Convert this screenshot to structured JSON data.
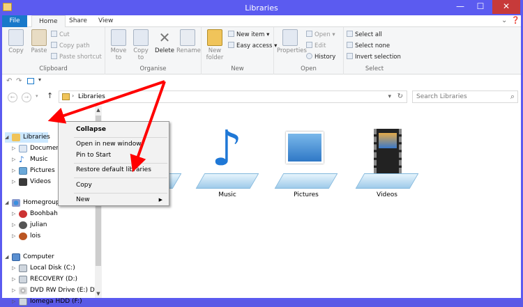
{
  "window": {
    "title": "Libraries",
    "minimize": "—",
    "maximize": "☐",
    "close": "✕"
  },
  "tabs": [
    "File",
    "Home",
    "Share",
    "View"
  ],
  "ribbon": {
    "clipboard": {
      "label": "Clipboard",
      "copy": "Copy",
      "paste": "Paste",
      "cut": "Cut",
      "copy_path": "Copy path",
      "paste_shortcut": "Paste shortcut"
    },
    "organise": {
      "label": "Organise",
      "move_to": "Move\nto",
      "copy_to": "Copy\nto",
      "delete": "Delete",
      "rename": "Rename"
    },
    "new": {
      "label": "New",
      "new_folder": "New\nfolder",
      "new_item": "New item",
      "easy_access": "Easy access"
    },
    "open": {
      "label": "Open",
      "properties": "Properties",
      "open": "Open",
      "edit": "Edit",
      "history": "History"
    },
    "select": {
      "label": "Select",
      "select_all": "Select all",
      "select_none": "Select none",
      "invert_selection": "Invert selection"
    }
  },
  "address": {
    "path": "Libraries",
    "search_placeholder": "Search Libraries"
  },
  "nav": {
    "libraries": "Libraries",
    "lib_items": [
      "Documents",
      "Music",
      "Pictures",
      "Videos"
    ],
    "homegroup": "Homegroup",
    "home_items": [
      "Boohbah",
      "julian",
      "lois"
    ],
    "computer": "Computer",
    "drives": [
      "Local Disk (C:)",
      "RECOVERY (D:)",
      "DVD RW Drive (E:) DVD",
      "Iomega HDD (F:)"
    ]
  },
  "libraries": [
    "Music",
    "Pictures",
    "Videos"
  ],
  "context_menu": [
    "Collapse",
    "Open in new window",
    "Pin to Start",
    "Restore default libraries",
    "Copy",
    "New"
  ],
  "colors": {
    "title_bar": "#5b5bf0",
    "file_tab": "#1979ca",
    "selection": "#cce8ff",
    "arrow": "#ff0000"
  }
}
